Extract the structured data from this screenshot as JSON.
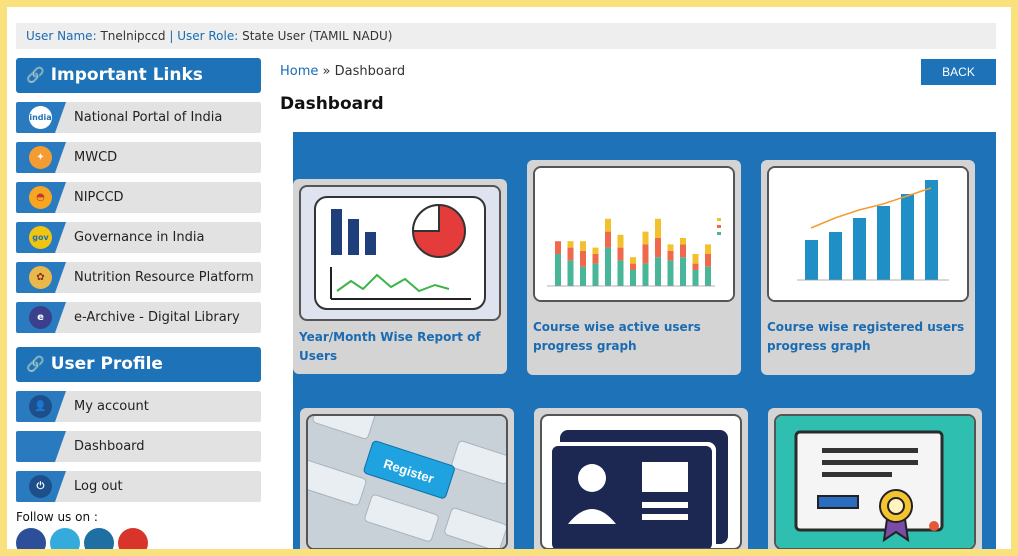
{
  "user": {
    "name_label": "User Name:",
    "name": "Tnelnipccd",
    "sep": "|",
    "role_label": "User Role:",
    "role": "State User (TAMIL NADU)"
  },
  "sidebar": {
    "important_links": {
      "title": "Important Links",
      "items": [
        {
          "label": "National Portal of India",
          "icon": "india-portal-icon"
        },
        {
          "label": "MWCD",
          "icon": "mwcd-icon"
        },
        {
          "label": "NIPCCD",
          "icon": "nipccd-icon"
        },
        {
          "label": "Governance in India",
          "icon": "mygov-icon"
        },
        {
          "label": "Nutrition Resource Platform",
          "icon": "nutrition-icon"
        },
        {
          "label": "e-Archive - Digital Library",
          "icon": "e-archive-icon"
        }
      ]
    },
    "user_profile": {
      "title": "User Profile",
      "items": [
        {
          "label": "My account",
          "icon": "user-icon"
        },
        {
          "label": "Dashboard",
          "icon": ""
        },
        {
          "label": "Log out",
          "icon": "power-icon"
        }
      ]
    },
    "follow_label": "Follow us on :"
  },
  "breadcrumb": {
    "home": "Home",
    "sep": "»",
    "current": "Dashboard"
  },
  "back_label": "BACK",
  "page_title": "Dashboard",
  "cards": [
    {
      "caption": "Year/Month Wise Report of Users"
    },
    {
      "caption": "Course wise active users progress graph"
    },
    {
      "caption": "Course wise registered users progress graph"
    },
    {
      "caption": ""
    },
    {
      "caption": ""
    },
    {
      "caption": ""
    }
  ],
  "thumb_texts": {
    "register_key": "Register"
  },
  "colors": {
    "accent": "#1d72b8",
    "background": "#f9e27d",
    "card": "#d4d4d4"
  }
}
